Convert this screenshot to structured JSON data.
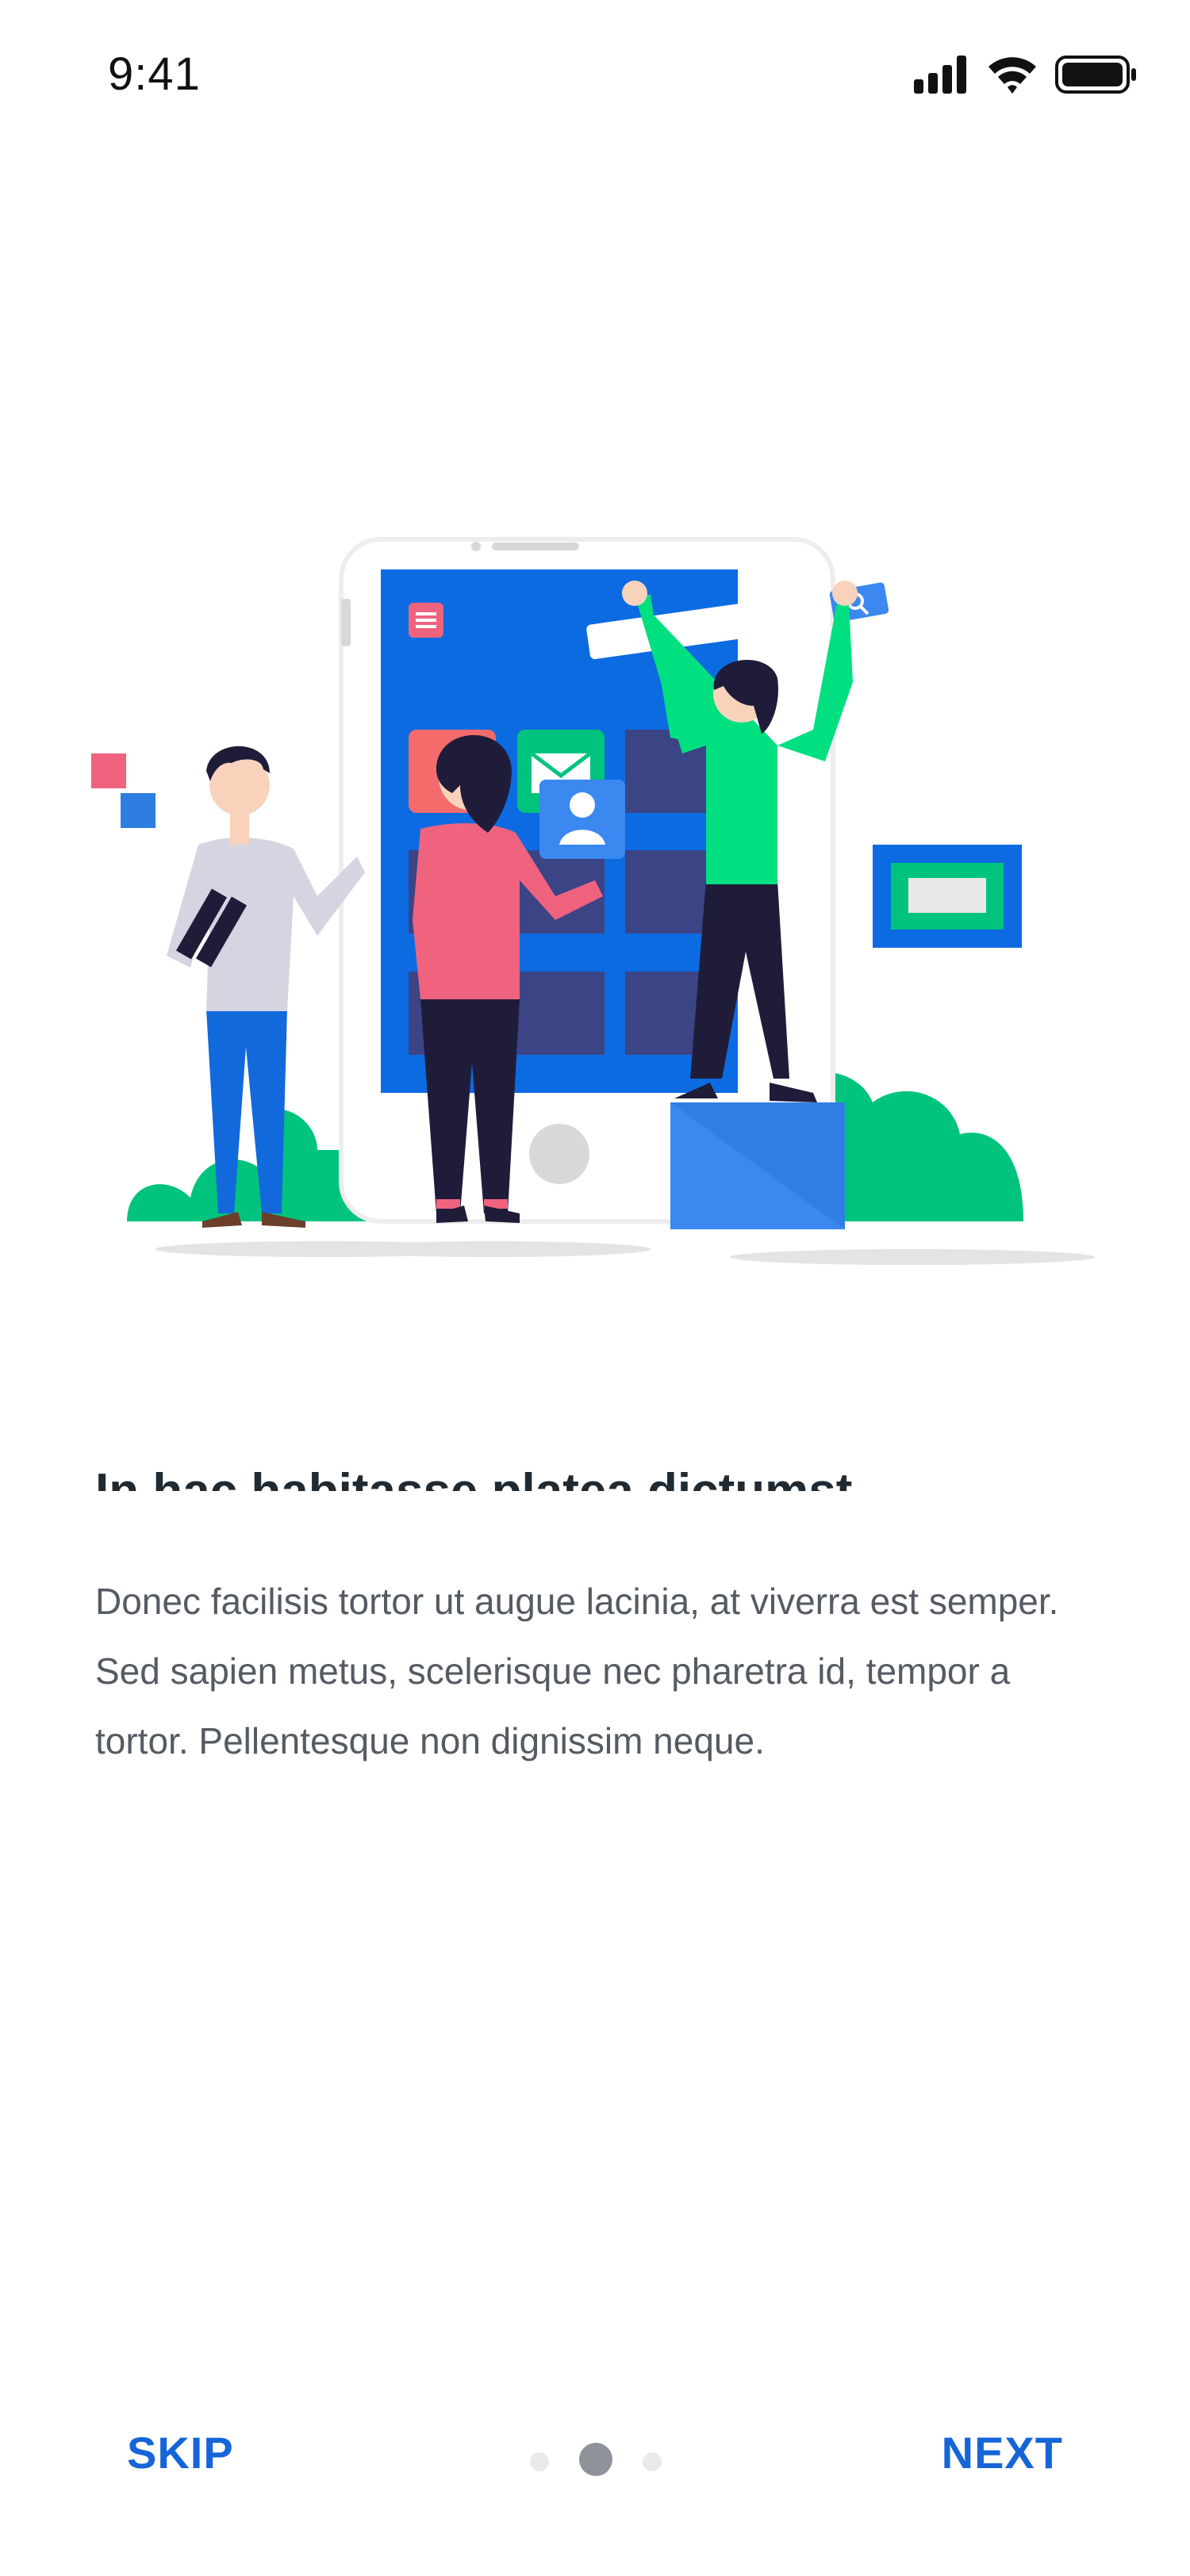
{
  "status_bar": {
    "time": "9:41",
    "icons": [
      "cellular-signal-icon",
      "wifi-icon",
      "battery-icon"
    ]
  },
  "illustration": {
    "description_icon": "team-building-app-illustration"
  },
  "content": {
    "title": "In hac habitasse platea dictumst",
    "body": "Donec facilisis tortor ut augue lacinia, at viverra est semper. Sed sapien metus, scelerisque nec pharetra id, tempor a tortor. Pellentesque non dignissim neque."
  },
  "footer": {
    "skip_label": "SKIP",
    "next_label": "NEXT",
    "page_indicator": {
      "total": 3,
      "current": 2
    }
  },
  "colors": {
    "accent": "#1565d8",
    "phone_blue": "#0c6be1",
    "green": "#00c47d",
    "pink": "#f0637f",
    "navy": "#272440"
  }
}
